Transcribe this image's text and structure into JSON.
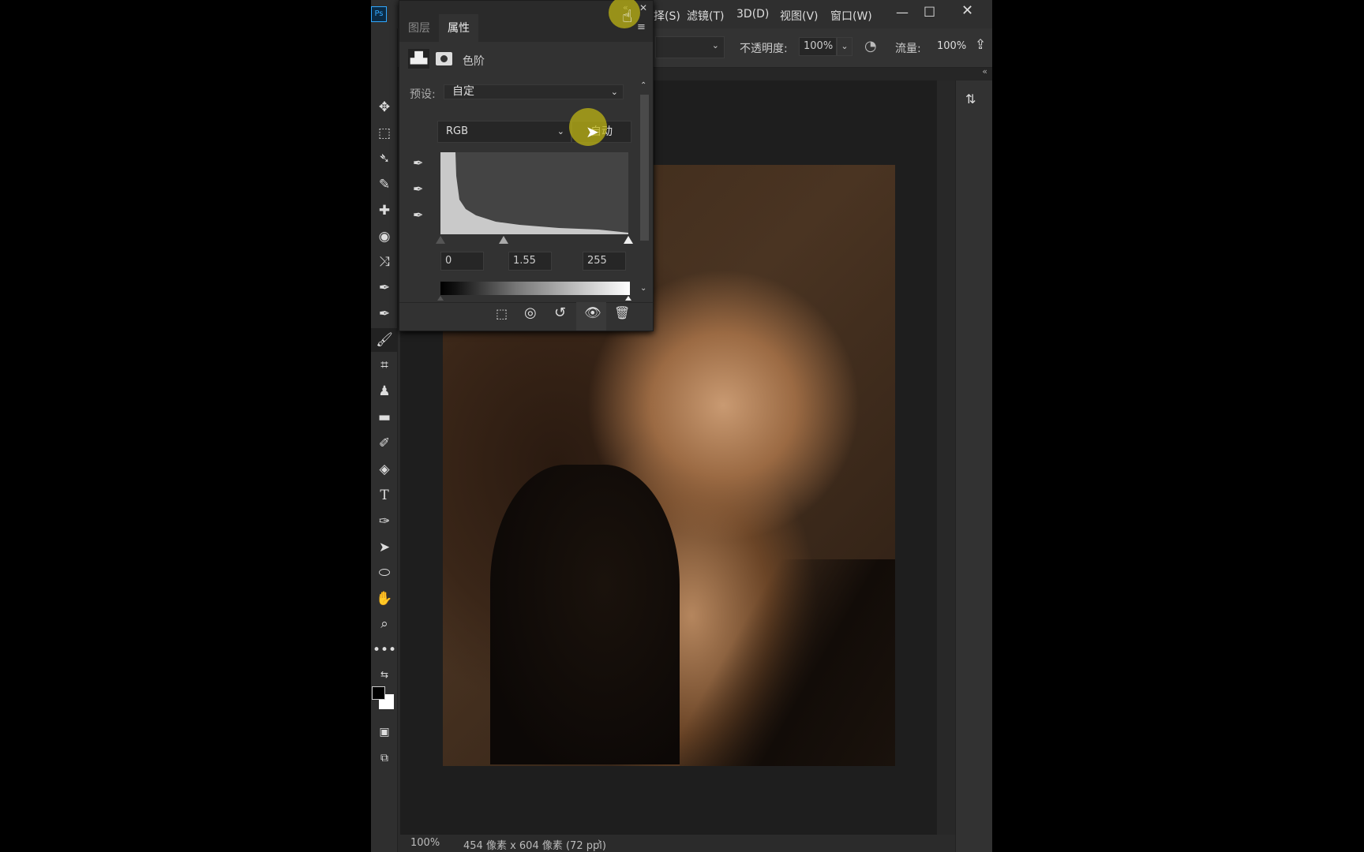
{
  "menubar": {
    "items": [
      "择(S)",
      "滤镜(T)",
      "3D(D)",
      "视图(V)",
      "窗口(W)"
    ],
    "app_icon": "ps-logo",
    "controls": [
      "minimize-icon",
      "maximize-icon",
      "close-icon"
    ]
  },
  "options": {
    "opacity_label": "不透明度:",
    "opacity_value": "100%",
    "flow_label": "流量:",
    "flow_value": "100%"
  },
  "panel": {
    "tabs": [
      {
        "label": "图层",
        "active": false
      },
      {
        "label": "属性",
        "active": true
      }
    ],
    "adjustment_title": "色阶",
    "preset_label": "预设:",
    "preset_value": "自定",
    "channel_value": "RGB",
    "auto_label": "自动",
    "input_black": "0",
    "input_gamma": "1.55",
    "input_white": "255",
    "footer_icons": [
      "clip-to-layer-icon",
      "view-previous-icon",
      "reset-icon",
      "visibility-icon",
      "delete-icon"
    ]
  },
  "status": {
    "zoom": "100%",
    "doc_info": "454 像素 x 604 像素 (72 ppi)",
    "arrow": "›"
  },
  "colors": {
    "ui_bg": "#2b2b2b",
    "panel_bg": "#323232",
    "cursor_highlight": "#bdb414"
  }
}
